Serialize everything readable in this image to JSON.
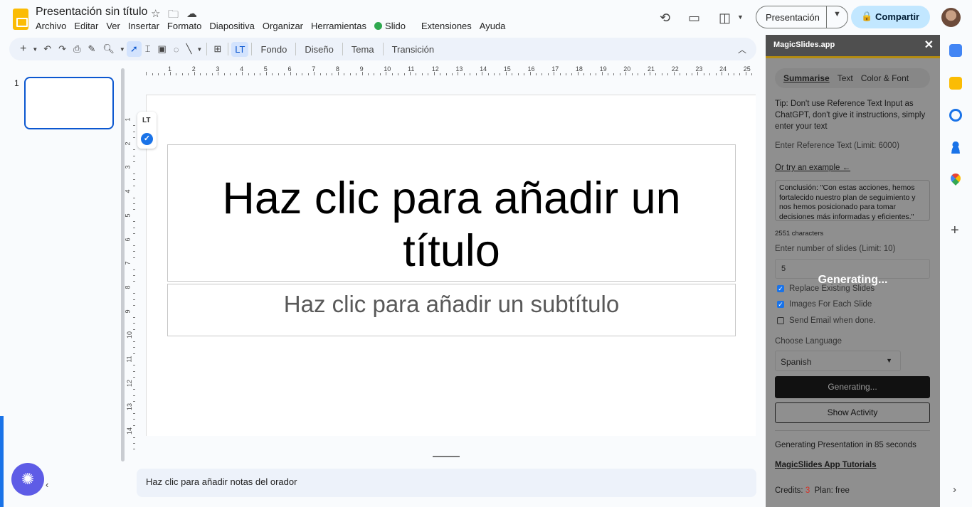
{
  "header": {
    "doc_title": "Presentación sin título",
    "menu": [
      "Archivo",
      "Editar",
      "Ver",
      "Insertar",
      "Formato",
      "Diapositiva",
      "Organizar",
      "Herramientas",
      "Slido",
      "Extensiones",
      "Ayuda"
    ],
    "present_label": "Presentación",
    "share_label": "Compartir"
  },
  "toolbar": {
    "buttons": [
      "Fondo",
      "Diseño",
      "Tema",
      "Transición"
    ]
  },
  "filmstrip": {
    "slide_number": "1"
  },
  "ruler": {
    "h_ticks": [
      "1",
      "2",
      "3",
      "4",
      "5",
      "6",
      "7",
      "8",
      "9",
      "10",
      "11",
      "12",
      "13",
      "14",
      "15",
      "16",
      "17",
      "18",
      "19",
      "20",
      "21",
      "22",
      "23",
      "24",
      "25"
    ],
    "v_ticks": [
      "1",
      "2",
      "3",
      "4",
      "5",
      "6",
      "7",
      "8",
      "9",
      "10",
      "11",
      "12",
      "13",
      "14"
    ]
  },
  "slide": {
    "title_placeholder": "Haz clic para añadir un título",
    "subtitle_placeholder": "Haz clic para añadir un subtítulo"
  },
  "notes": {
    "placeholder": "Haz clic para añadir notas del orador"
  },
  "panel": {
    "title": "MagicSlides.app",
    "tabs": [
      "Summarise",
      "Text",
      "Color & Font"
    ],
    "tip": "Tip: Don't use Reference Text Input as ChatGPT, don't give it instructions, simply enter your text",
    "reference_placeholder": "Enter Reference Text (Limit: 6000)",
    "example_link": "Or try an example ←",
    "example_text": "Conclusión: \"Con estas acciones, hemos fortalecido nuestro plan de seguimiento y nos hemos posicionado para tomar decisiones más informadas y eficientes.\"",
    "char_count": "2551 characters",
    "slides_label": "Enter number of slides (Limit: 10)",
    "slides_value": "5",
    "generating_overlay": "Generating...",
    "options": [
      {
        "label": "Replace Existing Slides",
        "checked": true
      },
      {
        "label": "Images For Each Slide",
        "checked": true
      },
      {
        "label": "Send Email when done.",
        "checked": false
      }
    ],
    "language_label": "Choose Language",
    "language_value": "Spanish",
    "generate_button": "Generating...",
    "activity_button": "Show Activity",
    "status": "Generating Presentation in 85 seconds",
    "tutorials_link": "MagicSlides App Tutorials",
    "credits_label": "Credits:",
    "credits_value": "3",
    "plan_label": "Plan:",
    "plan_value": "free"
  },
  "colors": {
    "accent": "#0b57d0",
    "panel_bg": "#8f8f8f",
    "share_bg": "#c2e7ff"
  }
}
